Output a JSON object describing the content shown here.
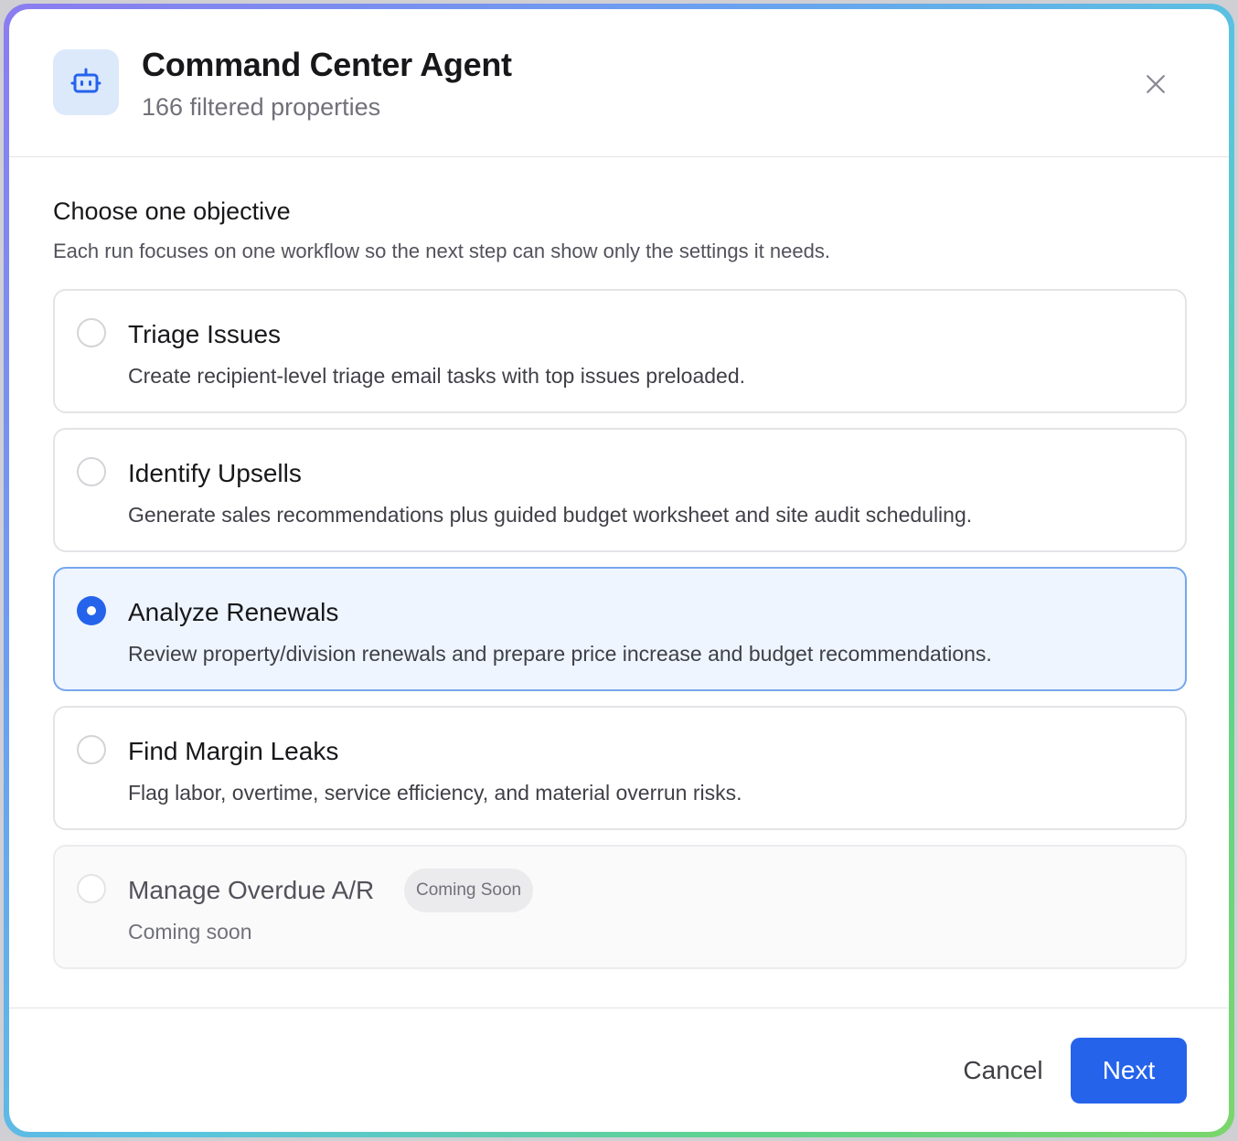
{
  "header": {
    "icon": "robot-icon",
    "title": "Command Center Agent",
    "subtitle": "166 filtered properties",
    "close_icon": "close-icon"
  },
  "section": {
    "title": "Choose one objective",
    "description": "Each run focuses on one workflow so the next step can show only the settings it needs."
  },
  "options": [
    {
      "title": "Triage Issues",
      "description": "Create recipient-level triage email tasks with top issues preloaded.",
      "selected": false,
      "disabled": false
    },
    {
      "title": "Identify Upsells",
      "description": "Generate sales recommendations plus guided budget worksheet and site audit scheduling.",
      "selected": false,
      "disabled": false
    },
    {
      "title": "Analyze Renewals",
      "description": "Review property/division renewals and prepare price increase and budget recommendations.",
      "selected": true,
      "disabled": false
    },
    {
      "title": "Find Margin Leaks",
      "description": "Flag labor, overtime, service efficiency, and material overrun risks.",
      "selected": false,
      "disabled": false
    },
    {
      "title": "Manage Overdue A/R",
      "description": "Coming soon",
      "badge": "Coming Soon",
      "selected": false,
      "disabled": true
    }
  ],
  "footer": {
    "cancel_label": "Cancel",
    "next_label": "Next"
  },
  "colors": {
    "accent": "#2563eb",
    "selected_bg": "#eef5ff",
    "selected_border": "#76a7ee",
    "icon_bg": "#dce9fb"
  }
}
